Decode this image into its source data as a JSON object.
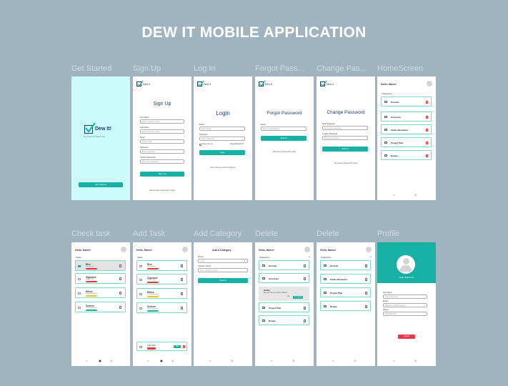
{
  "title": "DEW IT MOBILE APPLICATION",
  "screen_labels": [
    "Get Started",
    "Sign Up",
    "Log In",
    "Forgot Pass...",
    "Change Pas...",
    "HomeScreen",
    "Check task",
    "Add Task",
    "Add Category",
    "Delete",
    "Delete",
    "Profile"
  ],
  "brand": {
    "name": "Dew It!",
    "small": "Dew It",
    "tagline": "Any Time it for Doesn't Go!",
    "accent": "#16b1a4",
    "splash_bg": "#ccfbfb"
  },
  "get_started": {
    "button": "Get Started"
  },
  "signup": {
    "heading": "Sign Up",
    "first_name": "First Name",
    "first_name_ph": "Enter your first name",
    "last_name": "Last Name",
    "last_name_ph": "Enter your last name",
    "email": "Email",
    "email_ph": "Enter email",
    "password": "Password",
    "password_ph": "Enter password",
    "confirm": "Confirm Password",
    "confirm_ph": "Re-enter password",
    "button": "Sign Up",
    "footer": "Already have an account? Login"
  },
  "login": {
    "heading": "Login",
    "email": "Email",
    "email_ph": "Enter email",
    "password": "Password",
    "password_ph": "Enter password",
    "remember": "Remember me",
    "forgot": "Forgot Password?",
    "button": "Login",
    "footer": "Don't have an account? Signup"
  },
  "forgot": {
    "heading": "Forgot Password",
    "email": "Email",
    "email_ph": "Enter email address",
    "button": "Submit",
    "footer": "Remember Password? Login"
  },
  "change": {
    "heading": "Change Password",
    "new_pw": "New Password",
    "new_pw_ph": "Enter new password",
    "confirm": "Confirm Password",
    "confirm_ph": "Re-type password",
    "button": "Submit",
    "footer": "Remember Password? Login"
  },
  "home": {
    "hello": "Hello, Name!",
    "section": "Categories",
    "categories": [
      "Errands",
      "Groceries",
      "Finals Reviewers",
      "Project Plan",
      "Recipe"
    ]
  },
  "check": {
    "hello": "Hello, Name!",
    "section": "Tasks",
    "tasks": [
      {
        "name": "Rice",
        "sub": "Grocery list",
        "tag": "#e53935"
      },
      {
        "name": "Capstone",
        "sub": "Project Plan",
        "tag": "#e53935"
      },
      {
        "name": "Ethics",
        "sub": "Finals Reviewers",
        "tag": "#f5c518"
      },
      {
        "name": "Science",
        "sub": "Finals Reviewers",
        "tag": "#16b1a4"
      }
    ]
  },
  "addtask": {
    "hello": "Hello, Name!",
    "section": "Tasks",
    "input": "Add Task",
    "button": "Add"
  },
  "addcat": {
    "heading": "Add a Category",
    "priority": "Priority",
    "priority_ph": "Level",
    "cat_name": "Category Name",
    "cat_name_ph": "Enter category name",
    "button": "Submit"
  },
  "delete1": {
    "hello": "Hello, Name!",
    "section": "Categories",
    "categories": [
      "Errands",
      "Groceries",
      "Project Plan",
      "Recipe"
    ],
    "dialog_title": "Delete",
    "dialog_text": "Are you sure you want to delete?",
    "dialog_no": "No",
    "dialog_yes": "Yes, Delete"
  },
  "delete2": {
    "hello": "Hello, Name!",
    "section": "Categories",
    "categories": [
      "Errands",
      "Finals Reviewers",
      "Project Plan",
      "Recipe"
    ]
  },
  "profile": {
    "name": "Juan Dela Cruz",
    "first_name": "First Name",
    "first_name_val": "Juan Dela Cruz",
    "email": "Email",
    "email_val": "juandelacruz@gmail.com",
    "phone": "Phone",
    "phone_val": "09123456789",
    "button": "Logout"
  }
}
